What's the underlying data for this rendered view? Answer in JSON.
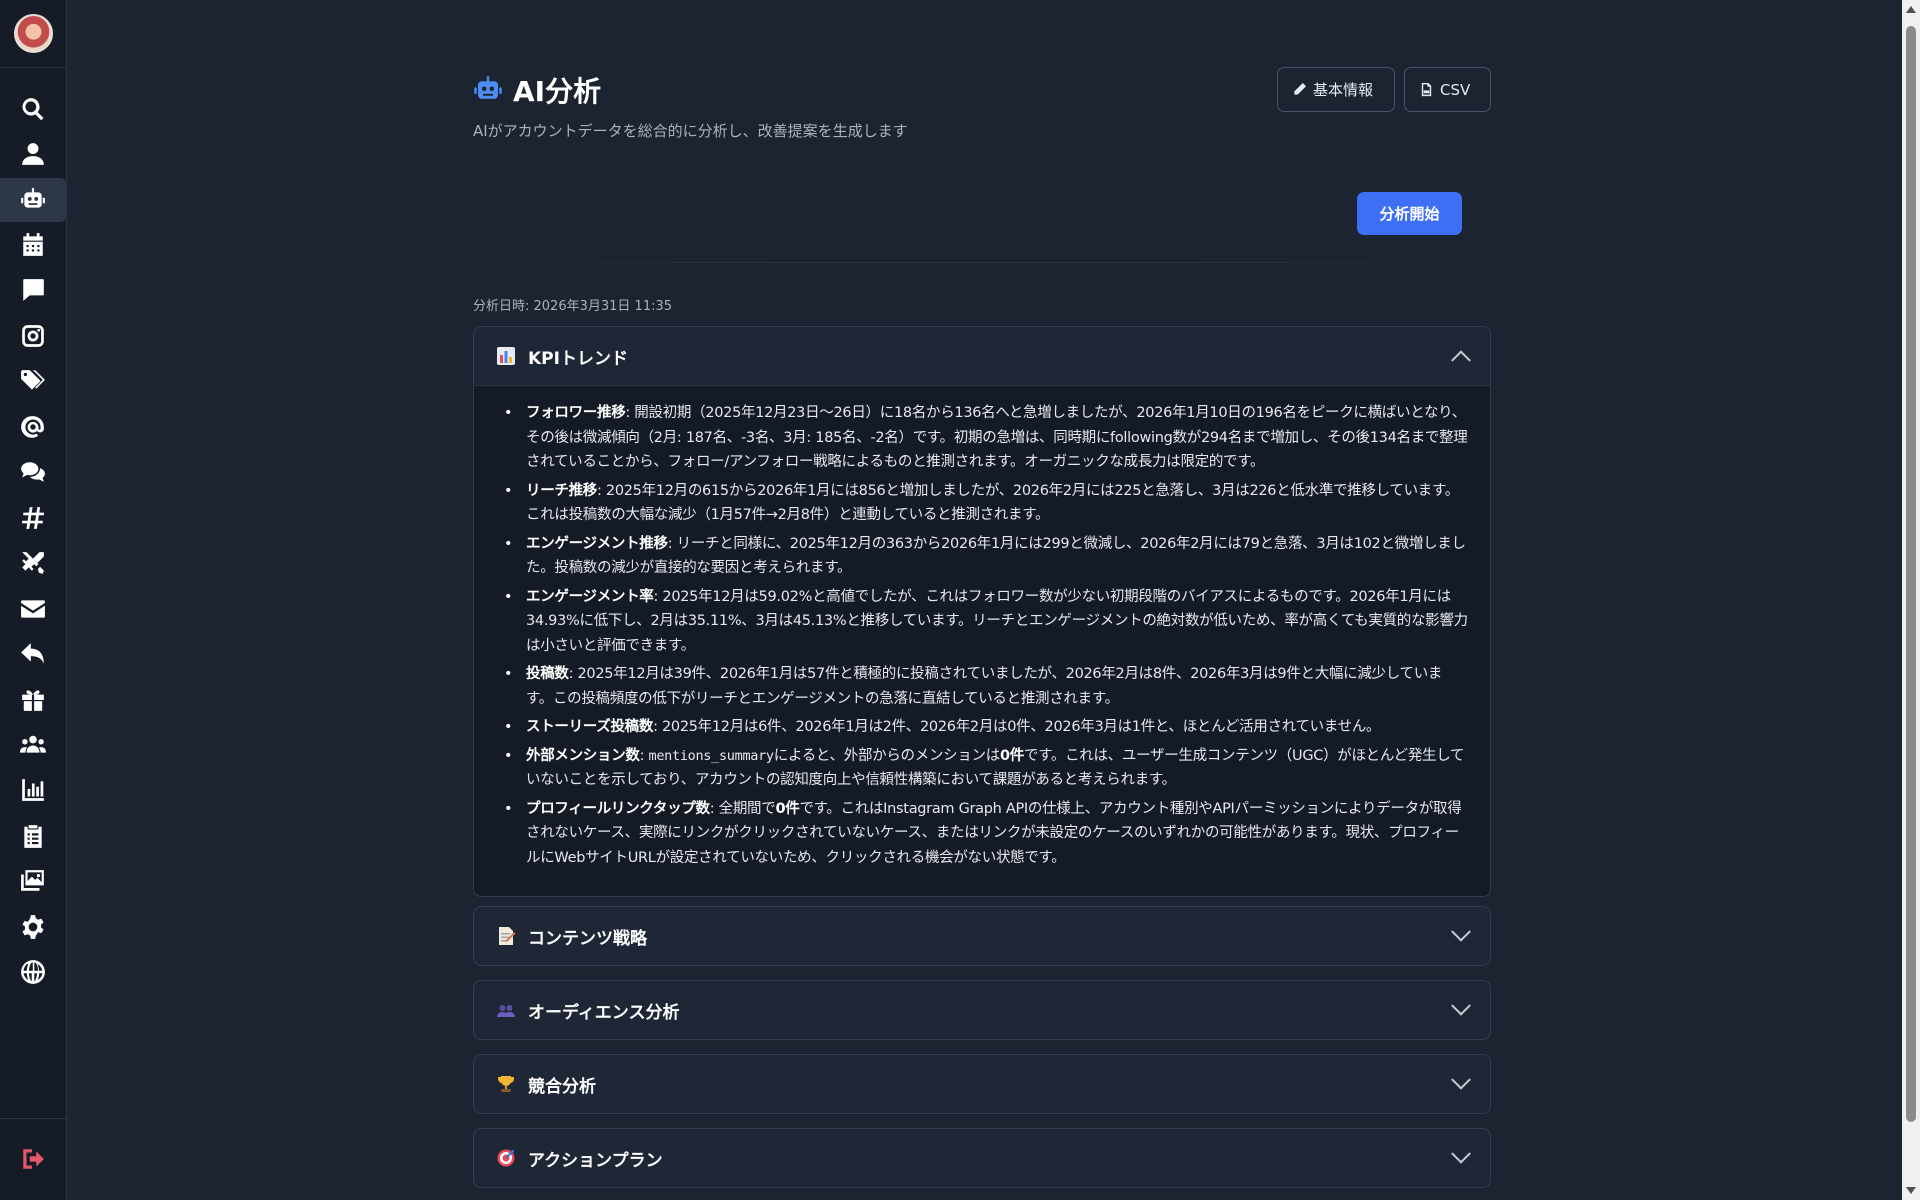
{
  "nav": {
    "items": [
      {
        "name": "search-icon"
      },
      {
        "name": "user-icon"
      },
      {
        "name": "robot-icon"
      },
      {
        "name": "calendar-icon"
      },
      {
        "name": "comment-icon"
      },
      {
        "name": "instagram-icon"
      },
      {
        "name": "tags-icon"
      },
      {
        "name": "at-icon"
      },
      {
        "name": "comments-icon"
      },
      {
        "name": "hashtag-icon"
      },
      {
        "name": "swords-icon"
      },
      {
        "name": "envelope-icon"
      },
      {
        "name": "reply-icon"
      },
      {
        "name": "gift-icon"
      },
      {
        "name": "users-icon"
      },
      {
        "name": "chart-bar-icon"
      },
      {
        "name": "clipboard-icon"
      },
      {
        "name": "images-icon"
      },
      {
        "name": "gear-icon"
      },
      {
        "name": "globe-icon"
      }
    ],
    "active": "robot-icon",
    "logout_icon": "sign-out-icon"
  },
  "header": {
    "title": "AI分析",
    "subtitle": "AIがアカウントデータを総合的に分析し、改善提案を生成します",
    "btn_info": "基本情報",
    "btn_csv": "CSV"
  },
  "actions": {
    "start": "分析開始"
  },
  "analysis_date": "分析日時: 2026年3月31日 11:35",
  "sections": {
    "kpi": {
      "title": "KPIトレンド",
      "icon": "chart-emoji",
      "items": [
        {
          "label": "フォロワー推移",
          "text": ": 開設初期（2025年12月23日〜26日）に18名から136名へと急増しましたが、2026年1月10日の196名をピークに横ばいとなり、その後は微減傾向（2月: 187名、-3名、3月: 185名、-2名）です。初期の急増は、同時期にfollowing数が294名まで増加し、その後134名まで整理されていることから、フォロー/アンフォロー戦略によるものと推測されます。オーガニックな成長力は限定的です。"
        },
        {
          "label": "リーチ推移",
          "text": ": 2025年12月の615から2026年1月には856と増加しましたが、2026年2月には225と急落し、3月は226と低水準で推移しています。これは投稿数の大幅な減少（1月57件→2月8件）と連動していると推測されます。"
        },
        {
          "label": "エンゲージメント推移",
          "text": ": リーチと同様に、2025年12月の363から2026年1月には299と微減し、2026年2月には79と急落、3月は102と微増しました。投稿数の減少が直接的な要因と考えられます。"
        },
        {
          "label": "エンゲージメント率",
          "text": ": 2025年12月は59.02%と高値でしたが、これはフォロワー数が少ない初期段階のバイアスによるものです。2026年1月には34.93%に低下し、2月は35.11%、3月は45.13%と推移しています。リーチとエンゲージメントの絶対数が低いため、率が高くても実質的な影響力は小さいと評価できます。"
        },
        {
          "label": "投稿数",
          "text": ": 2025年12月は39件、2026年1月は57件と積極的に投稿されていましたが、2026年2月は8件、2026年3月は9件と大幅に減少しています。この投稿頻度の低下がリーチとエンゲージメントの急落に直結していると推測されます。"
        },
        {
          "label": "ストーリーズ投稿数",
          "text": ": 2025年12月は6件、2026年1月は2件、2026年2月は0件、2026年3月は1件と、ほとんど活用されていません。"
        },
        {
          "label": "外部メンション数",
          "pre": ": ",
          "code": "mentions_summary",
          "mid": "によると、外部からのメンションは",
          "bold2": "0件",
          "text": "です。これは、ユーザー生成コンテンツ（UGC）がほとんど発生していないことを示しており、アカウントの認知度向上や信頼性構築において課題があると考えられます。"
        },
        {
          "label": "プロフィールリンクタップ数",
          "pre": ": 全期間で",
          "bold2": "0件",
          "text": "です。これはInstagram Graph APIの仕様上、アカウント種別やAPIパーミッションによりデータが取得されないケース、実際にリンクがクリックされていないケース、またはリンクが未設定のケースのいずれかの可能性があります。現状、プロフィールにWebサイトURLが設定されていないため、クリックされる機会がない状態です。"
        }
      ]
    },
    "content": {
      "title": "コンテンツ戦略",
      "icon": "memo-emoji"
    },
    "audience": {
      "title": "オーディエンス分析",
      "icon": "people-emoji"
    },
    "competitor": {
      "title": "競合分析",
      "icon": "trophy-emoji"
    },
    "action": {
      "title": "アクションプラン",
      "icon": "target-emoji"
    }
  }
}
